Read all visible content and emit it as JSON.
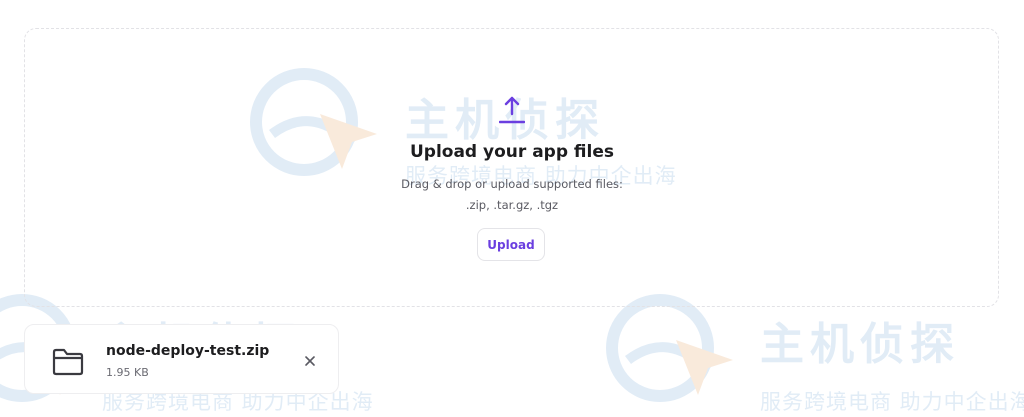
{
  "upload": {
    "icon": "upload-arrow-icon",
    "title": "Upload your app files",
    "subtitle": "Drag & drop or upload supported files:",
    "formats": ".zip, .tar.gz, .tgz",
    "button_label": "Upload"
  },
  "file": {
    "icon": "folder-icon",
    "name": "node-deploy-test.zip",
    "size": "1.95 KB",
    "remove_icon": "close-icon"
  },
  "watermark": {
    "title": "主机侦探",
    "subtitle": "服务跨境电商 助力中企出海"
  },
  "colors": {
    "accent": "#6b3fe0",
    "text": "#1d1d1f",
    "muted": "#5a5a62",
    "border": "#e2e2e6",
    "watermark": "#c9ddf0"
  }
}
